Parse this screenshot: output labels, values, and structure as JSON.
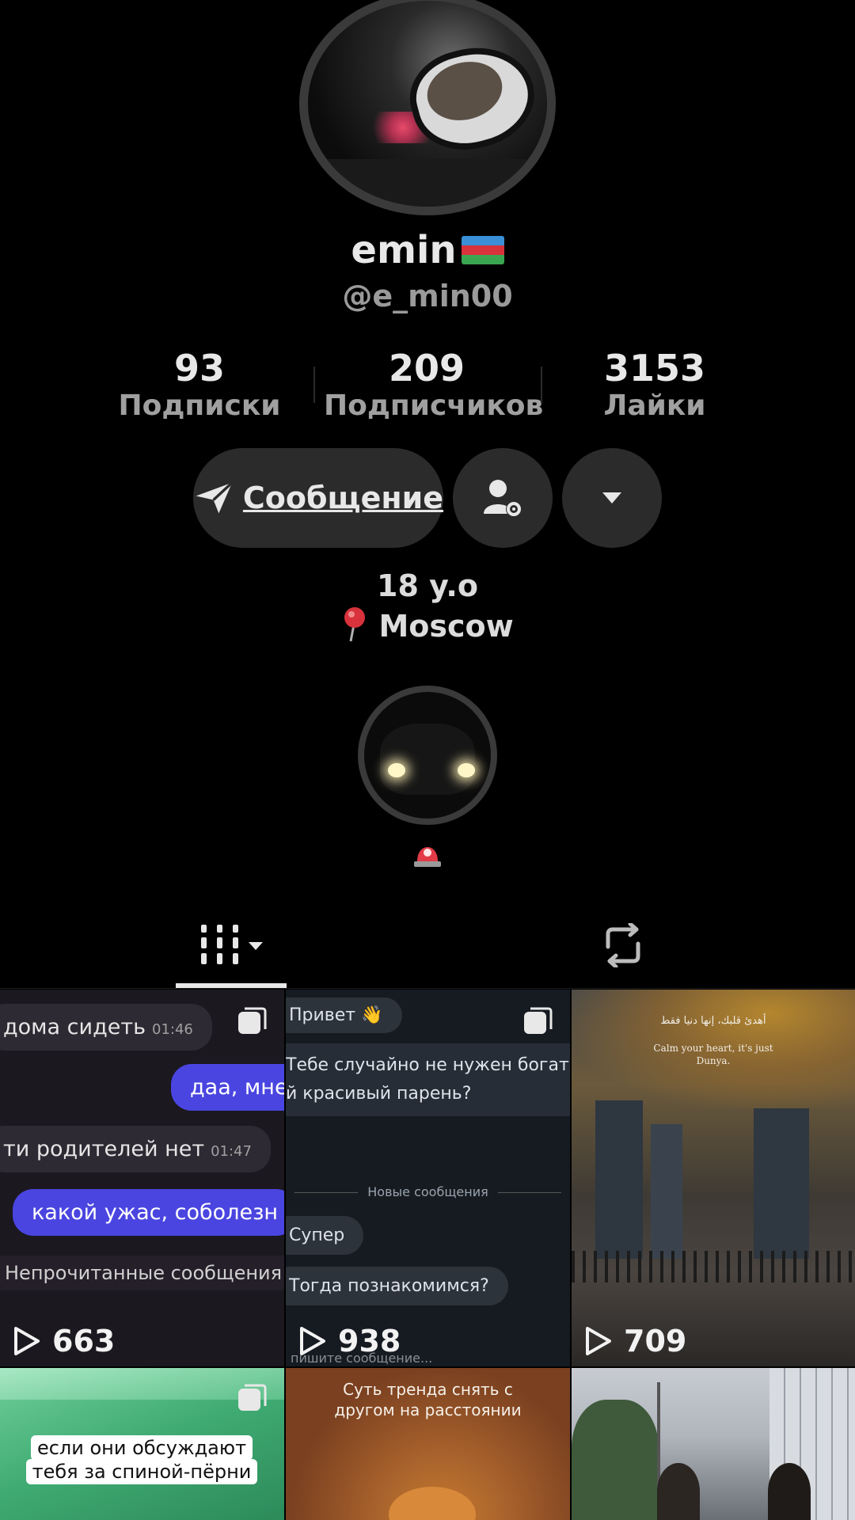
{
  "profile": {
    "name": "emin",
    "flag": "azerbaijan-flag",
    "handle": "@e_min00"
  },
  "stats": [
    {
      "value": "93",
      "label": "Подписки"
    },
    {
      "value": "209",
      "label": "Подписчиков"
    },
    {
      "value": "3153",
      "label": "Лайки"
    }
  ],
  "actions": {
    "message_label": "Сообщение",
    "message_icon": "send-icon",
    "friends_icon": "user-settings-icon",
    "more_icon": "chevron-down-icon"
  },
  "bio": {
    "line1": "18 y.o",
    "line2_icon": "pushpin-icon",
    "line2": "Moscow"
  },
  "highlight": {
    "icon": "police-light-icon"
  },
  "tabs": [
    {
      "icon": "grid-icon",
      "active": true
    },
    {
      "icon": "repost-icon",
      "active": false
    }
  ],
  "videos": [
    {
      "views": "663",
      "messages": [
        {
          "text": "дома сидеть",
          "time": "01:46"
        },
        {
          "text": "даа, мне"
        },
        {
          "text": "ти родителей нет",
          "time": "01:47"
        },
        {
          "text": "какой ужас, соболезн"
        },
        {
          "text": "Непрочитанные сообщения"
        }
      ]
    },
    {
      "views": "938",
      "messages": [
        {
          "text": "Привет 👋"
        },
        {
          "text": "Тебе случайно не нужен богать"
        },
        {
          "text": "й красивый парень?"
        },
        {
          "text": "Новые сообщения"
        },
        {
          "text": "Супер"
        },
        {
          "text": "Тогда познакомимся?"
        },
        {
          "text": "пишите сообщение..."
        }
      ]
    },
    {
      "views": "709",
      "overlay_arabic": "أهدئ قلبك، إنها دنيا فقط",
      "overlay_english": "Calm your heart, it's just Dunya."
    },
    {
      "caption": "если они обсуждают тебя за спиной-пёрни"
    },
    {
      "caption": "Суть тренда снять с другом на расстоянии"
    },
    {}
  ],
  "colors": {
    "background": "#000000",
    "button": "#2b2b2b",
    "accent_blue": "#4a45e0"
  }
}
